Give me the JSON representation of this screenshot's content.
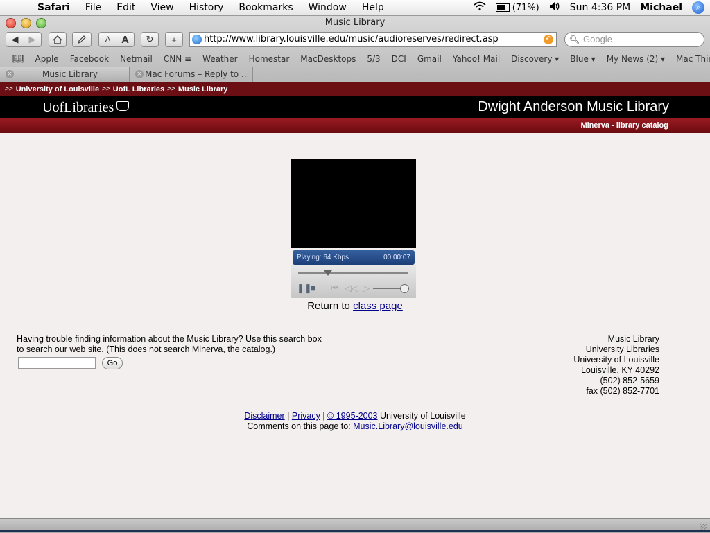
{
  "menubar": {
    "apple": "",
    "app": "Safari",
    "menus": [
      "File",
      "Edit",
      "View",
      "History",
      "Bookmarks",
      "Window",
      "Help"
    ],
    "battery": "(71%)",
    "clock": "Sun 4:36 PM",
    "user": "Michael"
  },
  "window": {
    "title": "Music Library",
    "url": "http://www.library.louisville.edu/music/audioreserves/redirect.asp",
    "search_placeholder": "Google",
    "font_small": "A",
    "font_large": "A"
  },
  "bookmarks": [
    "Apple",
    "Facebook",
    "Netmail",
    "CNN ≡",
    "Weather",
    "Homestar",
    "MacDesktops",
    "5/3",
    "DCI",
    "Gmail",
    "Yahoo! Mail",
    "Discovery ▾",
    "Blue ▾",
    "My News (2) ▾",
    "Mac Things ▾"
  ],
  "tabs": [
    {
      "label": "Music Library"
    },
    {
      "label": "Mac Forums – Reply to ..."
    }
  ],
  "page": {
    "breadcrumbs": [
      "University of Louisville",
      "UofL Libraries",
      "Music Library"
    ],
    "logo_text": "UofLibraries",
    "library_name": "Dwight Anderson Music Library",
    "catalog_link": "Minerva - library catalog",
    "player": {
      "status": "Playing: 64 Kbps",
      "time": "00:00:07",
      "progress": 0.27,
      "volume": 0.75
    },
    "return_prefix": "Return to",
    "return_link": "class page",
    "help_text_1": "Having trouble finding information about the Music Library? Use this search box",
    "help_text_2": "to search our web site. (This does not search Minerva, the catalog.)",
    "go_label": "Go",
    "address": [
      "Music Library",
      "University Libraries",
      "University of Louisville",
      "Louisville, KY 40292",
      "(502) 852-5659",
      "fax (502) 852-7701"
    ],
    "footer": {
      "disclaimer": "Disclaimer",
      "privacy": "Privacy",
      "copyright": "© 1995-2003",
      "org": "University of Louisville",
      "comments_prefix": "Comments on this page to:",
      "email": "Music.Library@louisville.edu"
    }
  }
}
